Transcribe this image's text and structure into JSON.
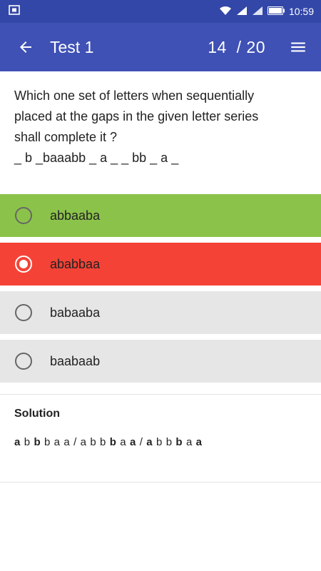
{
  "status": {
    "time": "10:59",
    "icons": [
      "screenshot-icon",
      "wifi-icon",
      "signal-icon",
      "3g-signal-icon",
      "battery-icon"
    ]
  },
  "app_bar": {
    "title": "Test 1",
    "counter": "14  / 20"
  },
  "question": {
    "lines": [
      "Which one set of letters when sequentially",
      "placed at the gaps in the given letter series",
      "shall complete it ?",
      "_ b _baaabb _ a _ _ bb _ a _"
    ]
  },
  "options": [
    {
      "label": "abbaaba",
      "state": "correct",
      "selected": false
    },
    {
      "label": "ababbaa",
      "state": "wrong",
      "selected": true
    },
    {
      "label": "babaaba",
      "state": "neutral",
      "selected": false
    },
    {
      "label": "baabaab",
      "state": "neutral",
      "selected": false
    }
  ],
  "solution": {
    "title": "Solution",
    "segments": [
      {
        "t": "a",
        "b": true
      },
      {
        "t": " b ",
        "b": false
      },
      {
        "t": "b",
        "b": true
      },
      {
        "t": " b a a / a b b ",
        "b": false
      },
      {
        "t": "b",
        "b": true
      },
      {
        "t": " a ",
        "b": false
      },
      {
        "t": "a",
        "b": true
      },
      {
        "t": " / ",
        "b": false
      },
      {
        "t": "a",
        "b": true
      },
      {
        "t": " b b ",
        "b": false
      },
      {
        "t": "b",
        "b": true
      },
      {
        "t": " a ",
        "b": false
      },
      {
        "t": "a",
        "b": true
      }
    ]
  },
  "colors": {
    "status_bar": "#3347a8",
    "app_bar": "#3f51b5",
    "correct": "#8bc34a",
    "wrong": "#f44336",
    "neutral": "#e6e6e6"
  }
}
